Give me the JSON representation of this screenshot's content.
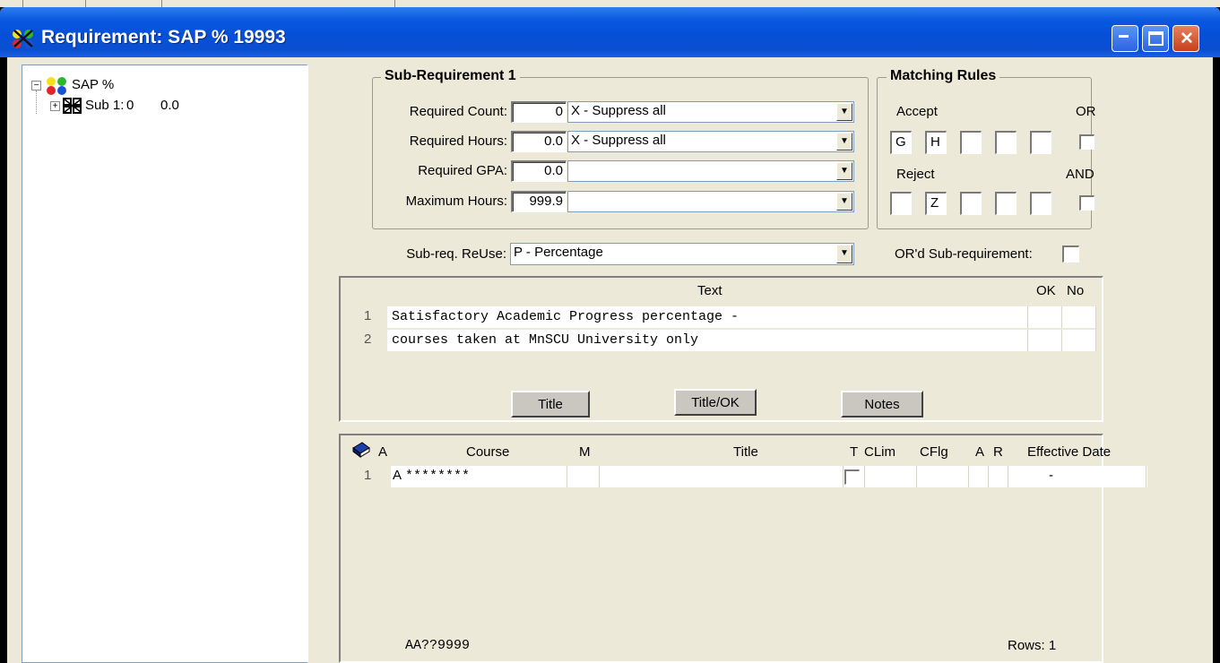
{
  "window": {
    "title": "Requirement: SAP % 19993",
    "min_glyph": "_",
    "max_glyph": "□",
    "close_glyph": "✕"
  },
  "tree": {
    "root_label": "SAP %",
    "root_expander": "−",
    "child_label": "Sub 1:",
    "child_count": "0",
    "child_value": "0.0",
    "child_expander": "+"
  },
  "sub_requirement": {
    "group_label": "Sub-Requirement 1",
    "required_count": {
      "label": "Required Count:",
      "value": "0",
      "option": "X - Suppress all"
    },
    "required_hours": {
      "label": "Required Hours:",
      "value": "0.0",
      "option": "X - Suppress all"
    },
    "required_gpa": {
      "label": "Required GPA:",
      "value": "0.0",
      "option": ""
    },
    "maximum_hours": {
      "label": "Maximum Hours:",
      "value": "999.9",
      "option": ""
    },
    "reuse": {
      "label": "Sub-req. ReUse:",
      "option": "P - Percentage"
    }
  },
  "matching_rules": {
    "group_label": "Matching Rules",
    "accept_label": "Accept",
    "or_label": "OR",
    "reject_label": "Reject",
    "and_label": "AND",
    "accept_cells": [
      "G",
      "H",
      "",
      "",
      ""
    ],
    "reject_cells": [
      "",
      "Z",
      "",
      "",
      ""
    ],
    "ord_sub_label": "OR'd Sub-requirement:"
  },
  "text_panel": {
    "col_text": "Text",
    "col_ok": "OK",
    "col_no": "No",
    "rows": [
      {
        "num": "1",
        "text": "Satisfactory Academic Progress percentage -"
      },
      {
        "num": "2",
        "text": "courses taken at MnSCU University only"
      }
    ],
    "buttons": {
      "title": "Title",
      "title_ok": "Title/OK",
      "notes": "Notes"
    }
  },
  "course_panel": {
    "columns": {
      "a": "A",
      "course": "Course",
      "m": "M",
      "title": "Title",
      "t": "T",
      "clim": "CLim",
      "cflg": "CFlg",
      "a2": "A",
      "r": "R",
      "eff": "Effective Date"
    },
    "rows": [
      {
        "num": "1",
        "a": "A",
        "course": "********",
        "eff": "-"
      }
    ],
    "mask": "AA??9999",
    "rows_count": "Rows: 1"
  },
  "colors": {
    "titlebar": "#0550d8",
    "window_bg": "#ece9d8"
  }
}
